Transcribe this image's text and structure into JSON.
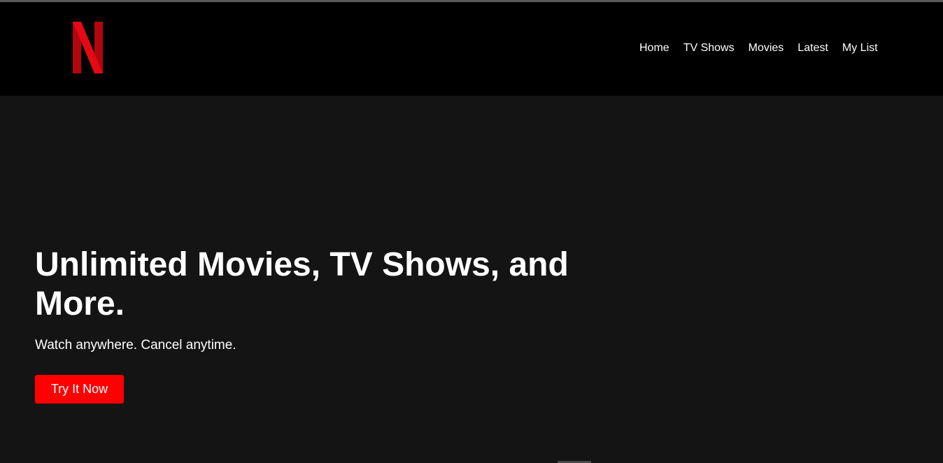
{
  "header": {
    "logo_text": "N",
    "nav": [
      {
        "label": "Home"
      },
      {
        "label": "TV Shows"
      },
      {
        "label": "Movies"
      },
      {
        "label": "Latest"
      },
      {
        "label": "My List"
      }
    ]
  },
  "hero": {
    "title": "Unlimited Movies, TV Shows, and More.",
    "subtitle": "Watch anywhere. Cancel anytime.",
    "cta_label": "Try It Now"
  },
  "colors": {
    "brand_red": "#e50914",
    "cta_red": "#ff0000",
    "header_bg": "#000000",
    "hero_bg": "#141414",
    "text": "#ffffff"
  }
}
